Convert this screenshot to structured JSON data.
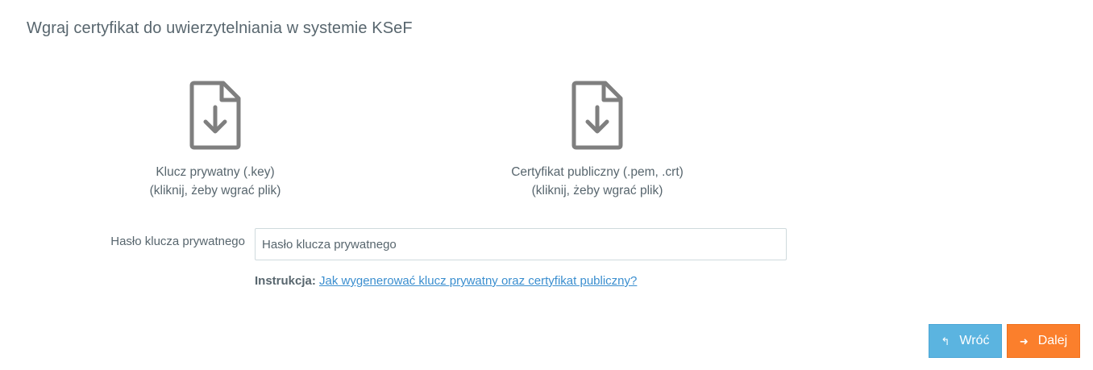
{
  "page": {
    "title": "Wgraj certyfikat do uwierzytelniania w systemie KSeF"
  },
  "upload": {
    "private_key": {
      "line1": "Klucz prywatny (.key)",
      "line2": "(kliknij, żeby wgrać plik)",
      "icon": "file-download-icon"
    },
    "public_cert": {
      "line1": "Certyfikat publiczny (.pem, .crt)",
      "line2": "(kliknij, żeby wgrać plik)",
      "icon": "file-download-icon"
    }
  },
  "password": {
    "label": "Hasło klucza prywatnego",
    "placeholder": "Hasło klucza prywatnego",
    "value": ""
  },
  "instruction": {
    "label": "Instrukcja:",
    "link_text": "Jak wygenerować klucz prywatny oraz certyfikat publiczny?"
  },
  "buttons": {
    "back": {
      "label": "Wróć",
      "icon": "reply-arrow-icon"
    },
    "next": {
      "label": "Dalej",
      "icon": "arrow-right-icon"
    }
  },
  "colors": {
    "text": "#58666e",
    "link": "#3a8ecf",
    "back_button": "#5bb4e0",
    "next_button": "#fb7f2c",
    "icon_gray": "#7f7f7f"
  }
}
